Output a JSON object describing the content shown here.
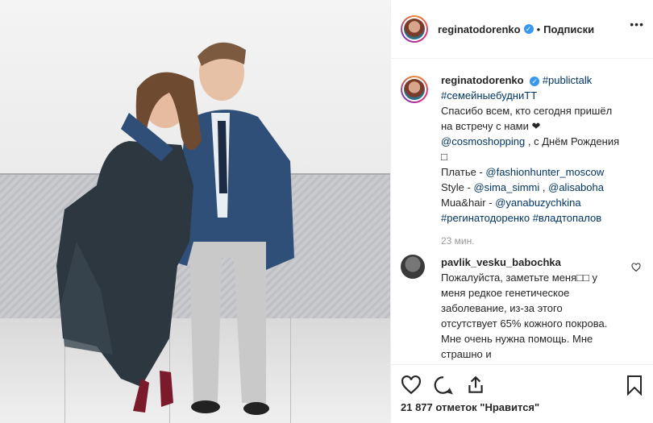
{
  "header": {
    "username": "reginatodorenko",
    "dot": "•",
    "follow_label": "Подписки",
    "more": "•••"
  },
  "caption": {
    "username": "reginatodorenko",
    "tag1": "#publictalk",
    "line1": "#семейныебудниТТ",
    "line2": "Спасибо всем, кто сегодня пришёл",
    "line3": "на встречу с нами ❤",
    "line4a": "@cosmoshopping",
    "line4b": " , с Днём Рождения",
    "line5": "□",
    "line6a": "Платье - ",
    "line6b": "@fashionhunter_moscow",
    "line7a": "Style - ",
    "line7b": "@sima_simmi",
    "line7c": " , ",
    "line7d": "@alisaboha",
    "line8a": "Mua&hair - ",
    "line8b": "@yanabuzychkina",
    "line9a": "#регинатодоренко",
    "line9b": " #владтопалов",
    "time": "23 мин."
  },
  "comment": {
    "username": "pavlik_vesku_babochka",
    "text": "Пожалуйста, заметьте меня□□ у меня редкое генетическое заболевание, из-за этого отсутствует 65% кожного покрова. Мне очень нужна помощь. Мне страшно и"
  },
  "actions": {
    "likes": "21 877 отметок \"Нравится\""
  },
  "icons": {
    "like": "heart-icon",
    "comment": "comment-icon",
    "share": "share-icon",
    "save": "bookmark-icon",
    "verified": "verified-badge-icon",
    "comment_like": "heart-outline-icon"
  },
  "colors": {
    "link": "#003569",
    "verified": "#3897f0",
    "muted": "#999999"
  }
}
